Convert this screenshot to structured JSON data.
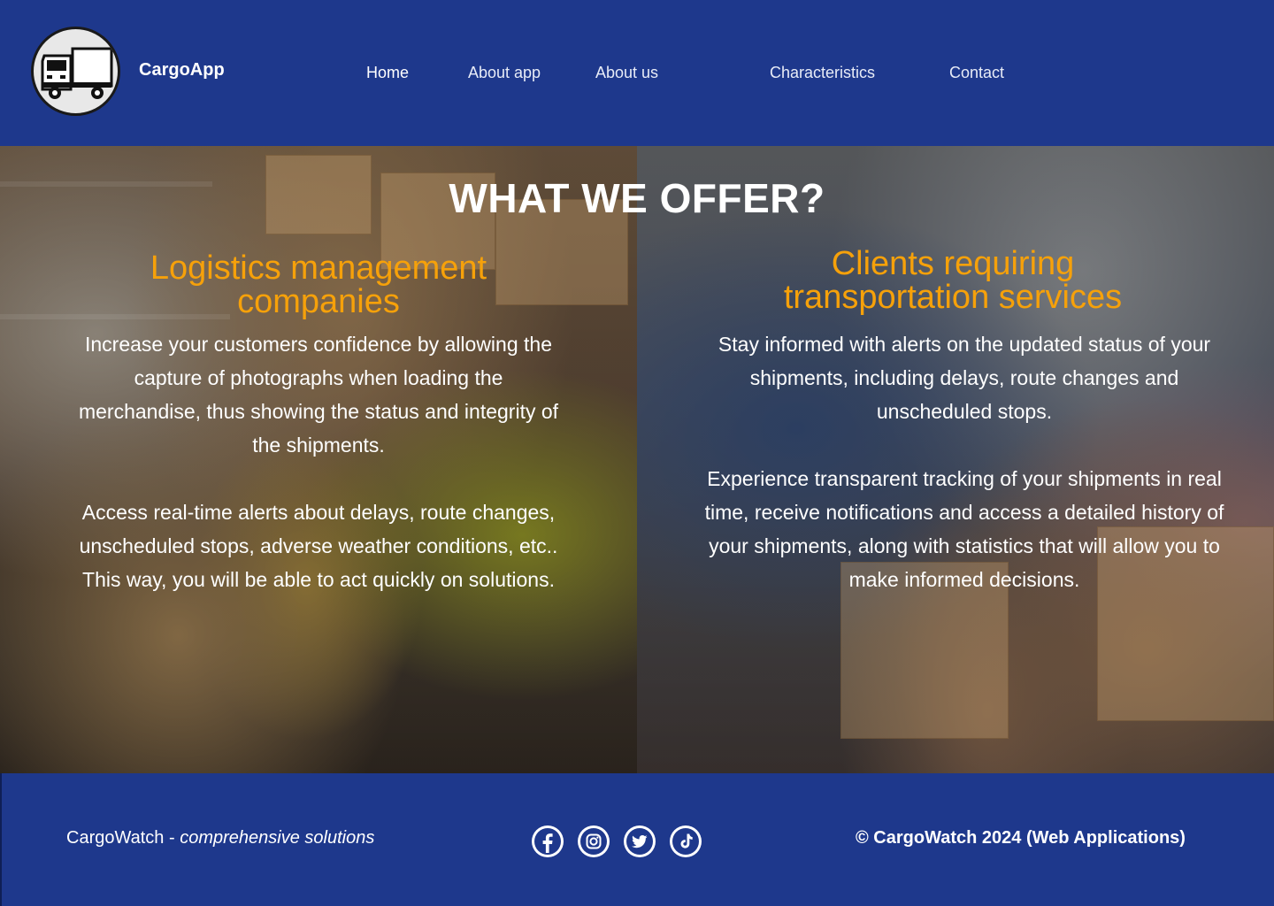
{
  "header": {
    "brand": "CargoApp",
    "logo_icon": "truck-icon",
    "nav": [
      {
        "label": "Home",
        "active": true
      },
      {
        "label": "About app",
        "active": false
      },
      {
        "label": "About us",
        "active": false
      },
      {
        "label": "Characteristics",
        "active": false
      },
      {
        "label": "Contact",
        "active": false
      }
    ]
  },
  "hero": {
    "title": "WHAT WE OFFER?",
    "left": {
      "title_line1": "Logistics management",
      "title_line2": "companies",
      "paragraphs": [
        "Increase your customers confidence by allowing the capture of photographs when loading the merchandise, thus showing the status and integrity of the shipments.",
        "Access real-time alerts about delays, route changes, unscheduled stops, adverse weather conditions, etc.. This way, you will be able to act quickly on solutions."
      ]
    },
    "right": {
      "title_line1": "Clients requiring",
      "title_line2": "transportation services",
      "paragraphs": [
        "Stay informed with alerts on the updated status of your shipments, including delays, route changes and unscheduled stops.",
        "Experience transparent tracking of your shipments in real time, receive notifications and access a detailed history of your shipments, along with statistics that will allow you to make informed decisions."
      ]
    }
  },
  "footer": {
    "brand": "CargoWatch",
    "separator": " - ",
    "tagline": "comprehensive solutions",
    "social": [
      "facebook-icon",
      "instagram-icon",
      "twitter-icon",
      "tiktok-icon"
    ],
    "copyright": "© CargoWatch 2024 (Web Applications)"
  },
  "colors": {
    "primary": "#1e388c",
    "accent": "#f6a10a",
    "text": "#ffffff"
  }
}
